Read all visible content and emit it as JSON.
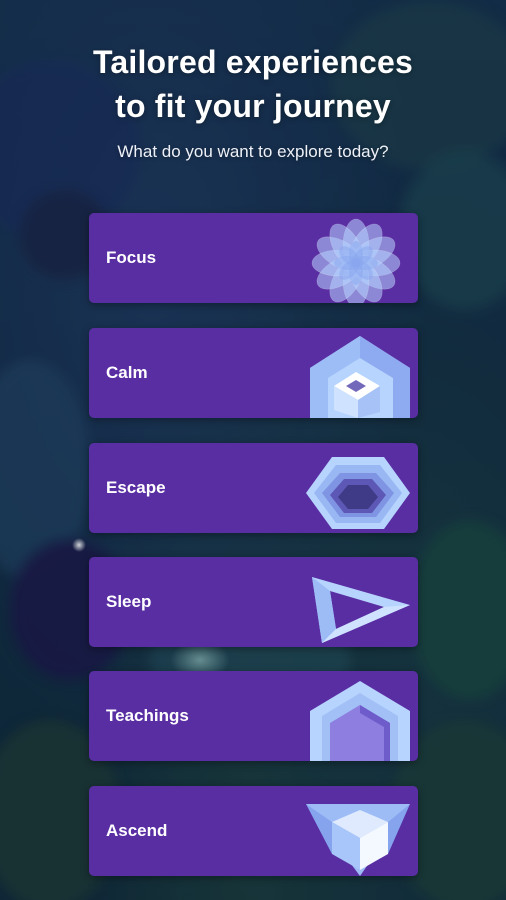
{
  "header": {
    "title_line1": "Tailored experiences",
    "title_line2": "to fit your journey",
    "subtitle": "What do you want to explore today?"
  },
  "experiences": [
    {
      "label": "Focus",
      "icon": "lotus-icon"
    },
    {
      "label": "Calm",
      "icon": "house-gem-icon"
    },
    {
      "label": "Escape",
      "icon": "hexagon-tunnel-icon"
    },
    {
      "label": "Sleep",
      "icon": "triangle-frame-icon"
    },
    {
      "label": "Teachings",
      "icon": "pentagon-icon"
    },
    {
      "label": "Ascend",
      "icon": "cube-gem-icon"
    }
  ],
  "colors": {
    "card": "#5a2ea3",
    "icon_light": "#b5d3ff",
    "icon_mid": "#8fb0ee",
    "icon_dark": "#4e46a0"
  }
}
